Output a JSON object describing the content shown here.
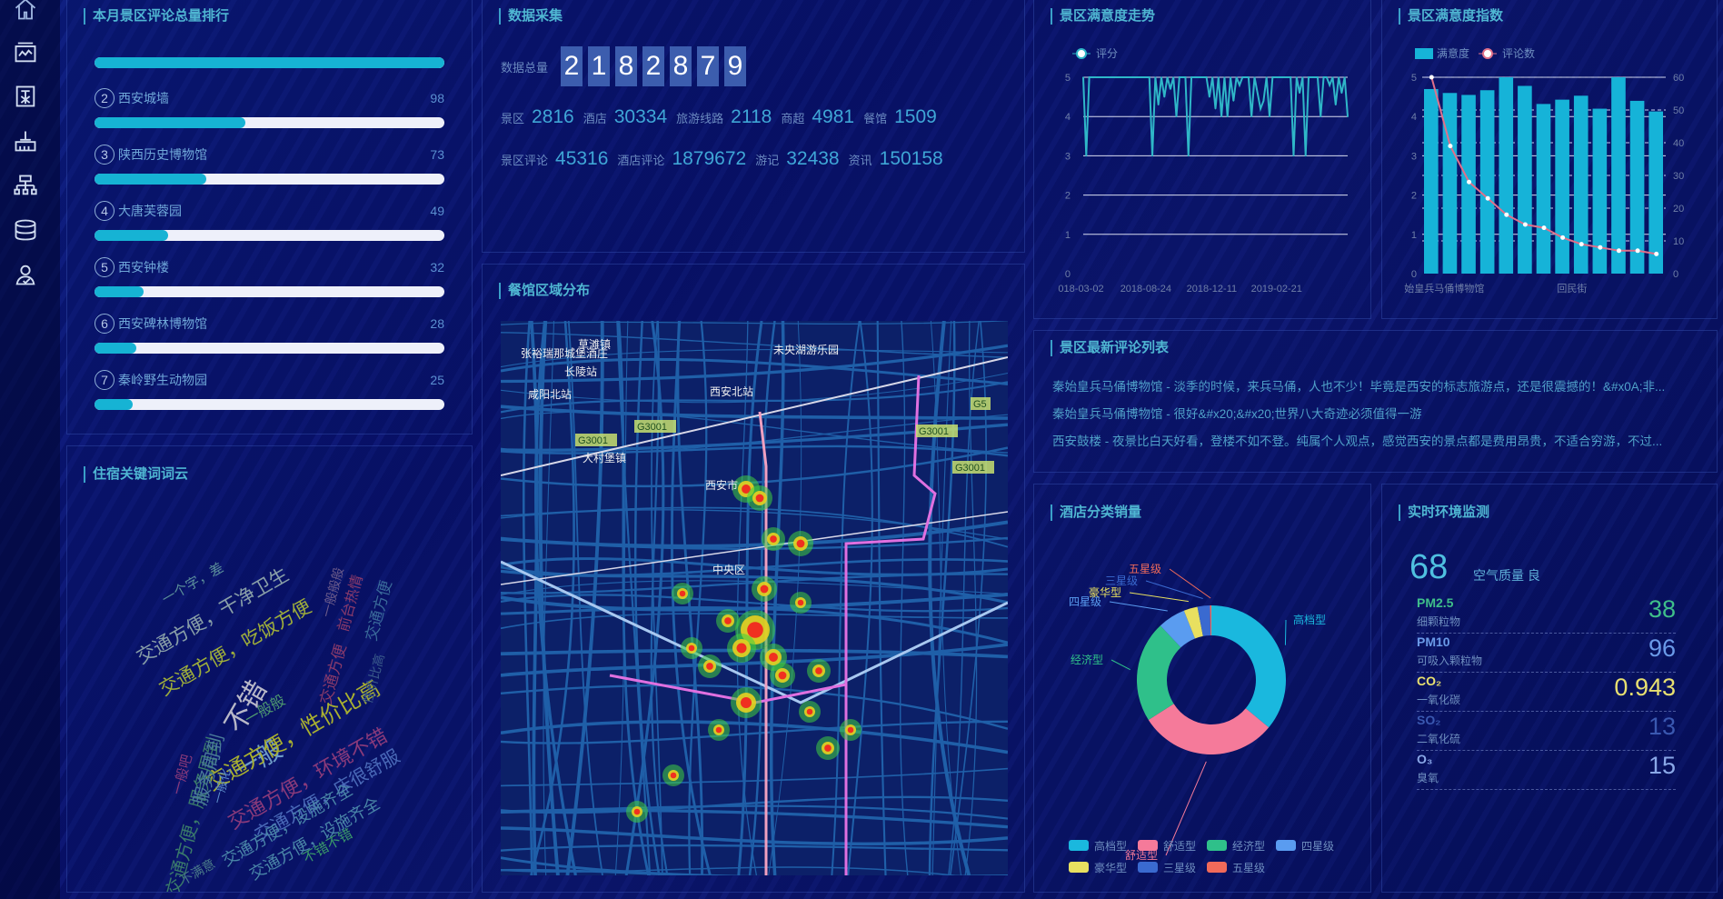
{
  "sidebar": {
    "items": [
      {
        "icon": "home-icon"
      },
      {
        "icon": "monitor-chart-icon"
      },
      {
        "icon": "building-icon"
      },
      {
        "icon": "factory-icon"
      },
      {
        "icon": "org-chart-icon"
      },
      {
        "icon": "database-icon"
      },
      {
        "icon": "user-icon"
      }
    ]
  },
  "ranking": {
    "title": "本月景区评论总量排行",
    "items": [
      {
        "rank": "",
        "name": "",
        "value": "",
        "fill_pct": 100
      },
      {
        "rank": "2",
        "name": "西安城墙",
        "value": "98",
        "fill_pct": 43
      },
      {
        "rank": "3",
        "name": "陕西历史博物馆",
        "value": "73",
        "fill_pct": 32
      },
      {
        "rank": "4",
        "name": "大唐芙蓉园",
        "value": "49",
        "fill_pct": 21
      },
      {
        "rank": "5",
        "name": "西安钟楼",
        "value": "32",
        "fill_pct": 14
      },
      {
        "rank": "6",
        "name": "西安碑林博物馆",
        "value": "28",
        "fill_pct": 12
      },
      {
        "rank": "7",
        "name": "秦岭野生动物园",
        "value": "25",
        "fill_pct": 11
      }
    ]
  },
  "wordcloud": {
    "title": "住宿关键词词云",
    "words": [
      {
        "text": "一个字，差",
        "color": "#5b8f9a"
      },
      {
        "text": "交通方便，干净卫生",
        "color": "#8aa0a8"
      },
      {
        "text": "交通方便，吃饭方便",
        "color": "#9fae3a"
      },
      {
        "text": "不错",
        "color": "#b8b8c8"
      },
      {
        "text": "一般般",
        "color": "#4f9a70"
      },
      {
        "text": "一般",
        "color": "#6d9ac8"
      },
      {
        "text": "交通方便，性价比高",
        "color": "#a9b030"
      },
      {
        "text": "交通方便，环境不错",
        "color": "#8a3a7a"
      },
      {
        "text": "交通方便，床很舒服",
        "color": "#4a6ab8"
      },
      {
        "text": "交通方便，设施齐全",
        "color": "#4a86a8"
      },
      {
        "text": "交通方便，设施齐全",
        "color": "#4a86a8"
      },
      {
        "text": "不错不错",
        "color": "#3a9a6a"
      },
      {
        "text": "不满意",
        "color": "#4a7a8a"
      },
      {
        "text": "交通方便，服务周到",
        "color": "#3a7a6a"
      },
      {
        "text": "服务周到",
        "color": "#4a7a9a"
      },
      {
        "text": "一般吧",
        "color": "#8a3a7a"
      },
      {
        "text": "一般化",
        "color": "#5a8ac8"
      },
      {
        "text": "交通方便",
        "color": "#8a3a6a"
      },
      {
        "text": "前台热情",
        "color": "#8a3a6a"
      },
      {
        "text": "一般般般",
        "color": "#6a5a8a"
      },
      {
        "text": "交通方便",
        "color": "#3a6a9a"
      },
      {
        "text": "性价比高",
        "color": "#3a5a8a"
      }
    ]
  },
  "collect": {
    "title": "数据采集",
    "total_label": "数据总量",
    "digits": [
      "2",
      "1",
      "8",
      "2",
      "8",
      "7",
      "9"
    ],
    "row1": [
      {
        "label": "景区",
        "value": "2816"
      },
      {
        "label": "酒店",
        "value": "30334"
      },
      {
        "label": "旅游线路",
        "value": "2118"
      },
      {
        "label": "商超",
        "value": "4981"
      },
      {
        "label": "餐馆",
        "value": "1509"
      }
    ],
    "row2": [
      {
        "label": "景区评论",
        "value": "45316"
      },
      {
        "label": "酒店评论",
        "value": "1879672"
      },
      {
        "label": "游记",
        "value": "32438"
      },
      {
        "label": "资讯",
        "value": "150158"
      }
    ]
  },
  "map": {
    "title": "餐馆区域分布",
    "labels": [
      "张裕瑞那城堡酒庄",
      "草滩镇",
      "长陵站",
      "咸阳北站",
      "西安北站",
      "未央湖游乐园",
      "G3001",
      "G3001",
      "G3001",
      "G3001",
      "西安市",
      "大村堡镇",
      "中央区",
      "G5"
    ]
  },
  "chart_data": [
    {
      "type": "line",
      "title": "景区满意度走势",
      "legend": [
        "评分"
      ],
      "ylim": [
        0,
        5
      ],
      "yticks": [
        "0",
        "1",
        "2",
        "3",
        "4",
        "5"
      ],
      "xticks": [
        "018-03-02",
        "2018-08-24",
        "2018-12-11",
        "2019-02-21"
      ],
      "series": [
        {
          "name": "评分",
          "values": [
            5,
            3,
            5,
            5,
            5,
            5,
            5,
            5,
            5,
            5,
            5,
            5,
            5,
            5,
            5,
            5,
            5,
            5,
            5,
            5,
            5,
            5,
            5,
            3,
            5,
            4.3,
            5,
            4.5,
            5,
            4.7,
            5,
            4,
            5,
            5,
            5,
            3,
            5,
            5,
            5,
            5,
            5,
            5,
            4.5,
            5,
            4.2,
            5,
            4,
            5,
            4,
            5,
            4.4,
            5,
            4.8,
            5,
            5,
            5,
            4,
            5,
            4.6,
            4.2,
            4.4,
            5,
            4,
            5,
            5,
            5,
            5,
            5,
            5,
            5,
            3,
            5,
            4.6,
            5,
            3,
            5,
            5,
            5,
            5,
            4,
            5,
            5,
            4.8,
            5,
            4.3,
            5,
            4.6,
            5,
            4
          ]
        }
      ],
      "color": "#2fb7c8"
    },
    {
      "type": "bar",
      "title": "景区满意度指数",
      "legend": [
        "满意度",
        "评论数"
      ],
      "ylim": [
        0,
        5
      ],
      "y2lim": [
        0,
        60
      ],
      "yticks": [
        "0",
        "1",
        "2",
        "3",
        "4",
        "5"
      ],
      "y2ticks": [
        "0",
        "10",
        "20",
        "30",
        "40",
        "50",
        "60"
      ],
      "xticks": [
        "始皇兵马俑博物馆",
        "回民街"
      ],
      "series": [
        {
          "name": "满意度",
          "values": [
            4.7,
            4.6,
            4.55,
            4.67,
            5.0,
            4.78,
            4.32,
            4.43,
            4.53,
            4.2,
            5.0,
            4.4,
            4.13
          ],
          "color": "#16b3d8"
        },
        {
          "name": "评论数",
          "axis": "right",
          "values": [
            60,
            39,
            28,
            23,
            18,
            15,
            14,
            11,
            9,
            8,
            7,
            7,
            6
          ],
          "color": "#e0708a"
        }
      ]
    },
    {
      "type": "pie",
      "title": "酒店分类销量",
      "categories": [
        "高档型",
        "舒适型",
        "经济型",
        "四星级",
        "豪华型",
        "三星级",
        "五星级"
      ],
      "values": [
        36,
        30,
        22,
        6,
        3,
        2.7,
        0.3
      ],
      "colors": [
        "#1ab8de",
        "#f57a9a",
        "#2fc08a",
        "#5a9cf0",
        "#e8e060",
        "#3a6ad0",
        "#f06a5a"
      ]
    }
  ],
  "comments": {
    "title": "景区最新评论列表",
    "items": [
      "秦始皇兵马俑博物馆 - 淡季的时候，来兵马俑，人也不少！毕竟是西安的标志旅游点，还是很震撼的！&#x0A;非...",
      "秦始皇兵马俑博物馆 - 很好&#x20;&#x20;世界八大奇迹必须值得一游",
      "西安鼓楼 - 夜景比白天好看，登楼不如不登。纯属个人观点，感觉西安的景点都是费用昂贵，不适合穷游，不过..."
    ]
  },
  "env": {
    "title": "实时环境监测",
    "aqi": "68",
    "aqi_label": "空气质量 良",
    "items": [
      {
        "key": "PM2.5",
        "sub": "细颗粒物",
        "value": "38",
        "color": "#3fbf8a"
      },
      {
        "key": "PM10",
        "sub": "可吸入颗粒物",
        "value": "96",
        "color": "#6a9ae8"
      },
      {
        "key": "CO₂",
        "sub": "一氧化碳",
        "value": "0.943",
        "color": "#e8e070"
      },
      {
        "key": "SO₂",
        "sub": "二氧化硫",
        "value": "13",
        "color": "#3a58b0"
      },
      {
        "key": "O₃",
        "sub": "臭氧",
        "value": "15",
        "color": "#8aa8e8"
      }
    ]
  }
}
